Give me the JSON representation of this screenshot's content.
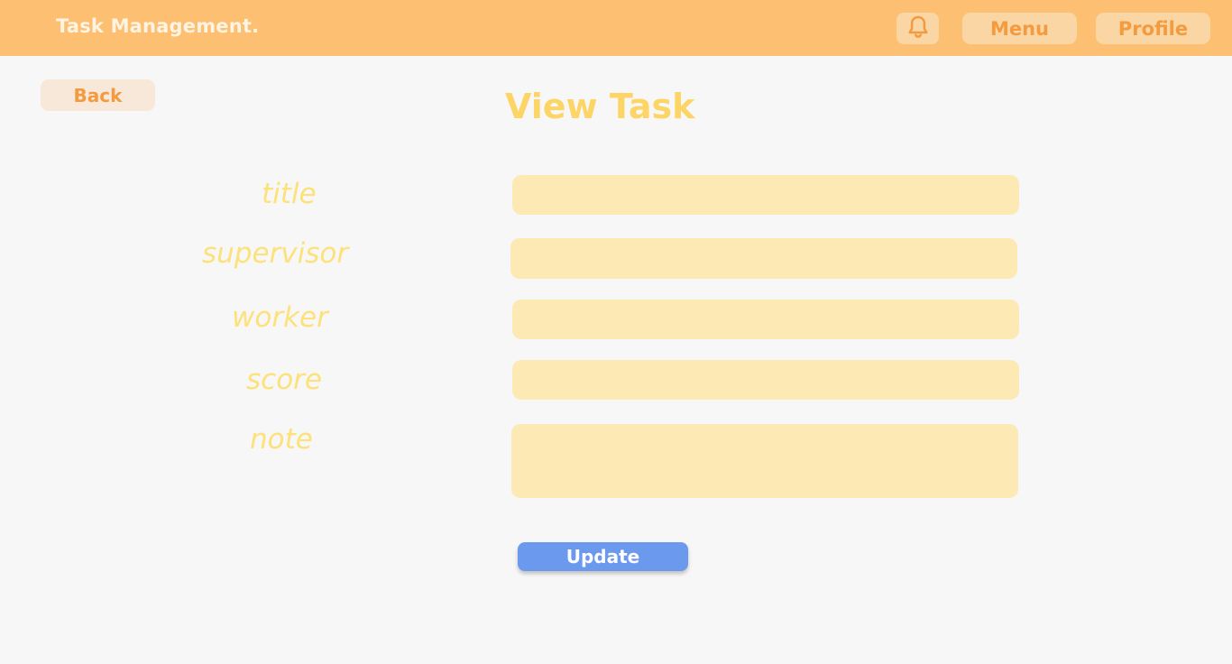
{
  "header": {
    "brand": "Task Management.",
    "bell_icon": "bell-icon",
    "menu_label": "Menu",
    "profile_label": "Profile"
  },
  "back_label": "Back",
  "page_title": "View Task",
  "form": {
    "fields": [
      {
        "label": "title",
        "value": "",
        "placeholder": ""
      },
      {
        "label": "supervisor",
        "value": "",
        "placeholder": ""
      },
      {
        "label": "worker",
        "value": "",
        "placeholder": ""
      },
      {
        "label": "score",
        "value": "",
        "placeholder": ""
      },
      {
        "label": "note",
        "value": "",
        "placeholder": ""
      }
    ],
    "submit_label": "Update"
  },
  "colors": {
    "header_bg": "#fdbf72",
    "accent_orange": "#f39b3e",
    "title_yellow": "#fdd567",
    "label_yellow": "#fde17b",
    "field_bg": "#fce9b4",
    "update_blue": "#6b99ee",
    "page_bg": "#f7f7f7"
  }
}
